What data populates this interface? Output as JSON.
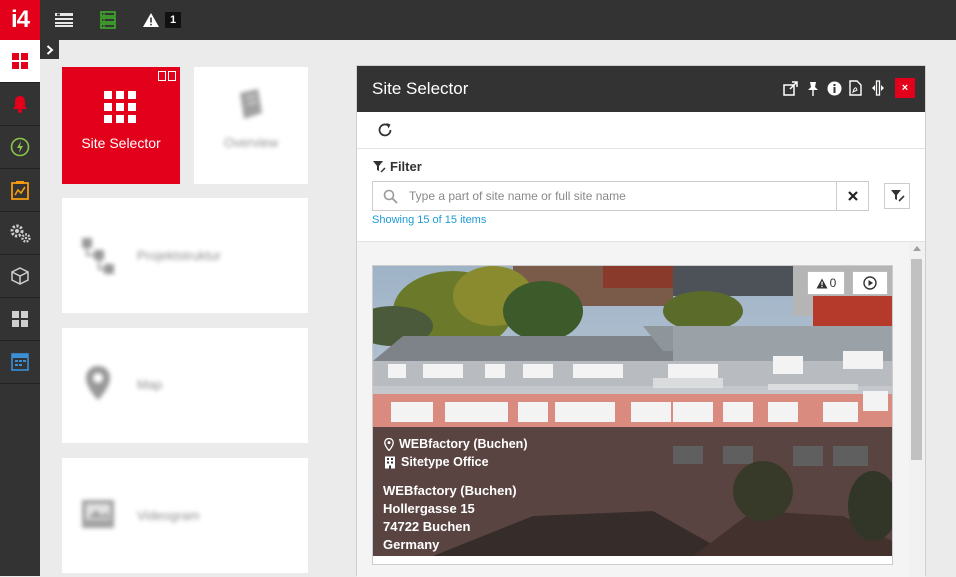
{
  "app": {
    "logo_text": "i4"
  },
  "topbar": {
    "icons": [
      "list-icon",
      "server-icon",
      "warning-icon"
    ],
    "alarm_count": "1",
    "colors": {
      "background": "#333333",
      "brand": "#e2001a",
      "server": "#3fae29"
    }
  },
  "sidebar": {
    "items": [
      {
        "icon": "grid-icon",
        "active": true
      },
      {
        "icon": "bell-icon"
      },
      {
        "icon": "lightning-icon"
      },
      {
        "icon": "report-icon"
      },
      {
        "icon": "gears-icon"
      },
      {
        "icon": "box-icon"
      },
      {
        "icon": "dashboard-icon"
      },
      {
        "icon": "calendar-icon"
      }
    ]
  },
  "tiles": [
    {
      "label": "Site Selector",
      "icon": "grid-icon",
      "active": true
    },
    {
      "label": "Overview",
      "icon": "document-icon"
    },
    {
      "label": "Projektstruktur",
      "icon": "tree-icon"
    },
    {
      "label": "Map",
      "icon": "map-pin-icon"
    },
    {
      "label": "Videogram",
      "icon": "image-icon"
    }
  ],
  "panel": {
    "title": "Site Selector",
    "header_icons": [
      "external-link-icon",
      "pin-icon",
      "info-icon",
      "pdf-icon",
      "resize-icon"
    ],
    "close_label": "×",
    "filter_label": "Filter",
    "search_placeholder": "Type a part of site name or full site name",
    "search_value": "",
    "showing_text": "Showing 15 of 15 items",
    "colors": {
      "link": "#1e9ad6"
    }
  },
  "sites": [
    {
      "location": "WEBfactory (Buchen)",
      "sitetype": "Sitetype Office",
      "address": [
        "WEBfactory (Buchen)",
        "Hollergasse 15",
        "74722 Buchen",
        "Germany"
      ],
      "alarm_count": "0"
    }
  ]
}
